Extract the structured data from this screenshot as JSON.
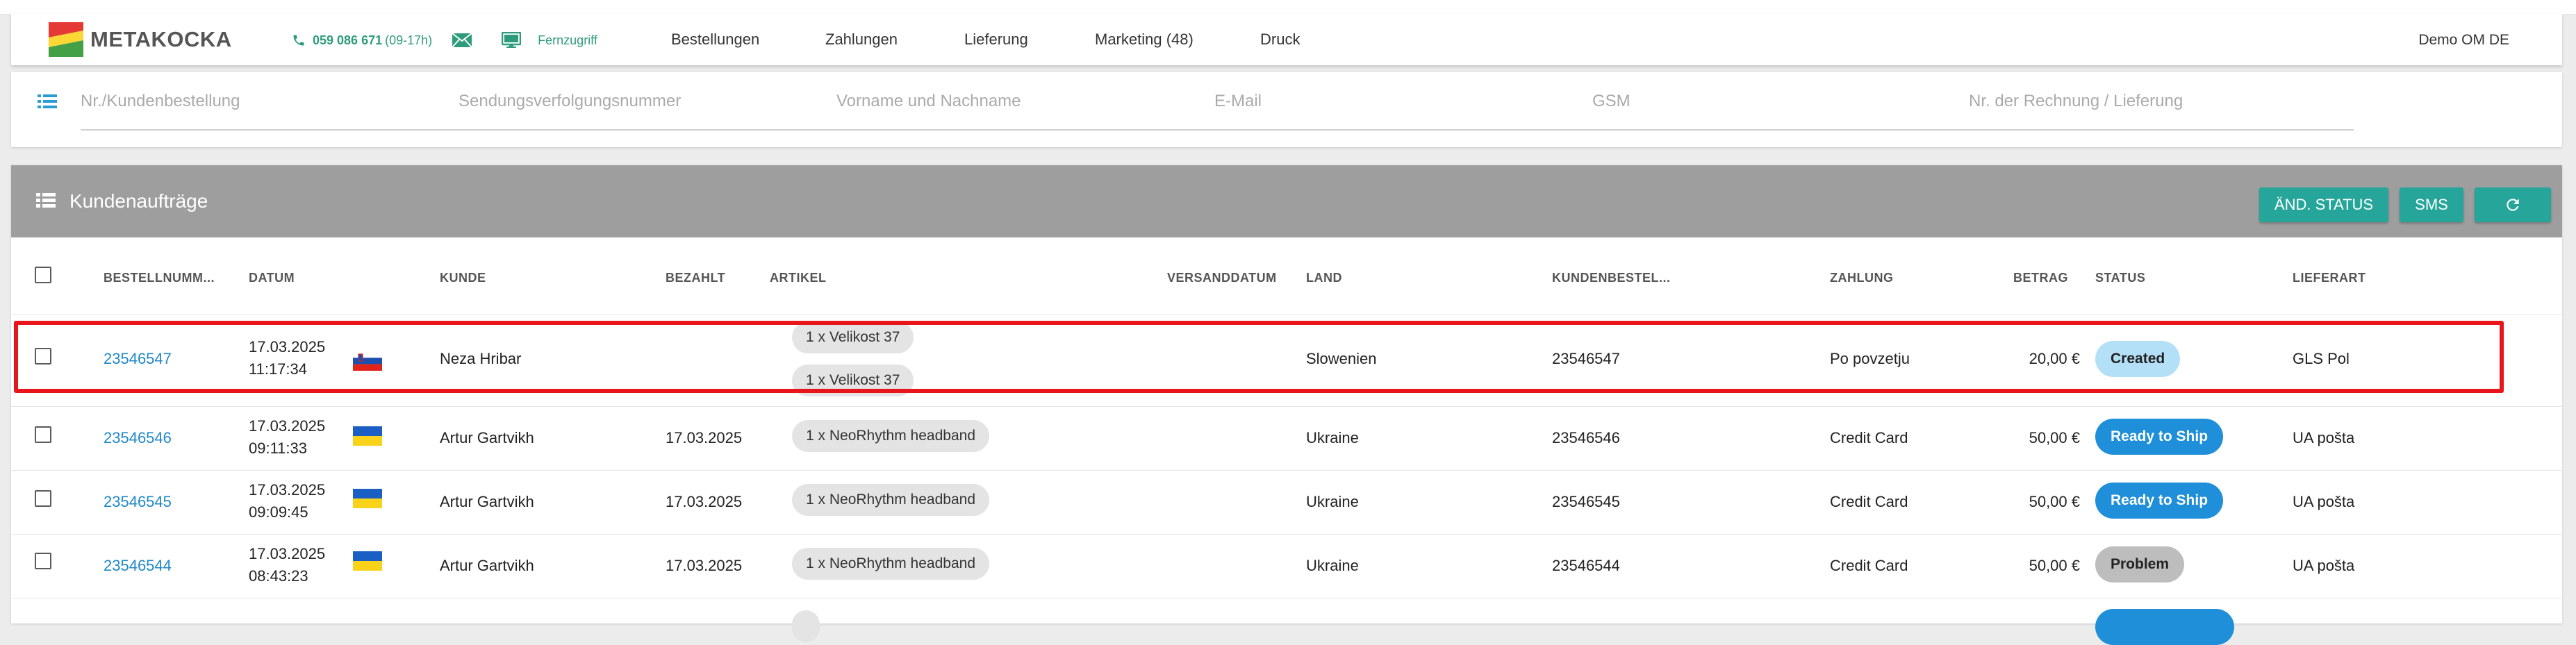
{
  "brand": {
    "name": "METAKOCKA"
  },
  "contact": {
    "phone": "059 086 671",
    "hours": "(09-17h)",
    "remote": "Fernzugriff"
  },
  "nav": [
    "Bestellungen",
    "Zahlungen",
    "Lieferung",
    "Marketing (48)",
    "Druck"
  ],
  "user": "Demo OM DE",
  "search": {
    "placeholders": [
      "Nr./Kundenbestellung",
      "Sendungsverfolgungsnummer",
      "Vorname und Nachname",
      "E-Mail",
      "GSM",
      "Nr. der Rechnung / Lieferung"
    ]
  },
  "orders": {
    "title": "Kundenaufträge",
    "buttons": {
      "change_status": "ÄND. STATUS",
      "sms": "SMS"
    },
    "columns": [
      "BESTELLNUMM...",
      "DATUM",
      "KUNDE",
      "BEZAHLT",
      "ARTIKEL",
      "VERSANDDATUM",
      "LAND",
      "KUNDENBESTEL...",
      "ZAHLUNG",
      "BETRAG",
      "STATUS",
      "LIEFERART"
    ],
    "rows": [
      {
        "number": "23546547",
        "date": "17.03.2025",
        "time": "11:17:34",
        "flag": "slovenia",
        "customer": "Neza Hribar",
        "paid": "",
        "items": [
          "1 x Velikost 37",
          "1 x Velikost 37"
        ],
        "ship_date": "",
        "country": "Slowenien",
        "customer_order": "23546547",
        "payment": "Po povzetju",
        "amount": "20,00 €",
        "status": "Created",
        "delivery": "GLS Pol"
      },
      {
        "number": "23546546",
        "date": "17.03.2025",
        "time": "09:11:33",
        "flag": "ukraine",
        "customer": "Artur Gartvikh",
        "paid": "17.03.2025",
        "items": [
          "1 x NeoRhythm headband"
        ],
        "ship_date": "",
        "country": "Ukraine",
        "customer_order": "23546546",
        "payment": "Credit Card",
        "amount": "50,00 €",
        "status": "Ready to Ship",
        "delivery": "UA pošta"
      },
      {
        "number": "23546545",
        "date": "17.03.2025",
        "time": "09:09:45",
        "flag": "ukraine",
        "customer": "Artur Gartvikh",
        "paid": "17.03.2025",
        "items": [
          "1 x NeoRhythm headband"
        ],
        "ship_date": "",
        "country": "Ukraine",
        "customer_order": "23546545",
        "payment": "Credit Card",
        "amount": "50,00 €",
        "status": "Ready to Ship",
        "delivery": "UA pošta"
      },
      {
        "number": "23546544",
        "date": "17.03.2025",
        "time": "08:43:23",
        "flag": "ukraine",
        "customer": "Artur Gartvikh",
        "paid": "17.03.2025",
        "items": [
          "1 x NeoRhythm headband"
        ],
        "ship_date": "",
        "country": "Ukraine",
        "customer_order": "23546544",
        "payment": "Credit Card",
        "amount": "50,00 €",
        "status": "Problem",
        "delivery": "UA pošta"
      }
    ]
  },
  "status_colors": {
    "Created": "#b3e0f7",
    "Ready to Ship": "#1e8fd8",
    "Problem": "#bdbdbd"
  },
  "accent": "#26a69a",
  "icons": [
    "phone-icon",
    "mail-icon",
    "monitor-icon",
    "list-icon",
    "refresh-icon",
    "flag-icon"
  ]
}
